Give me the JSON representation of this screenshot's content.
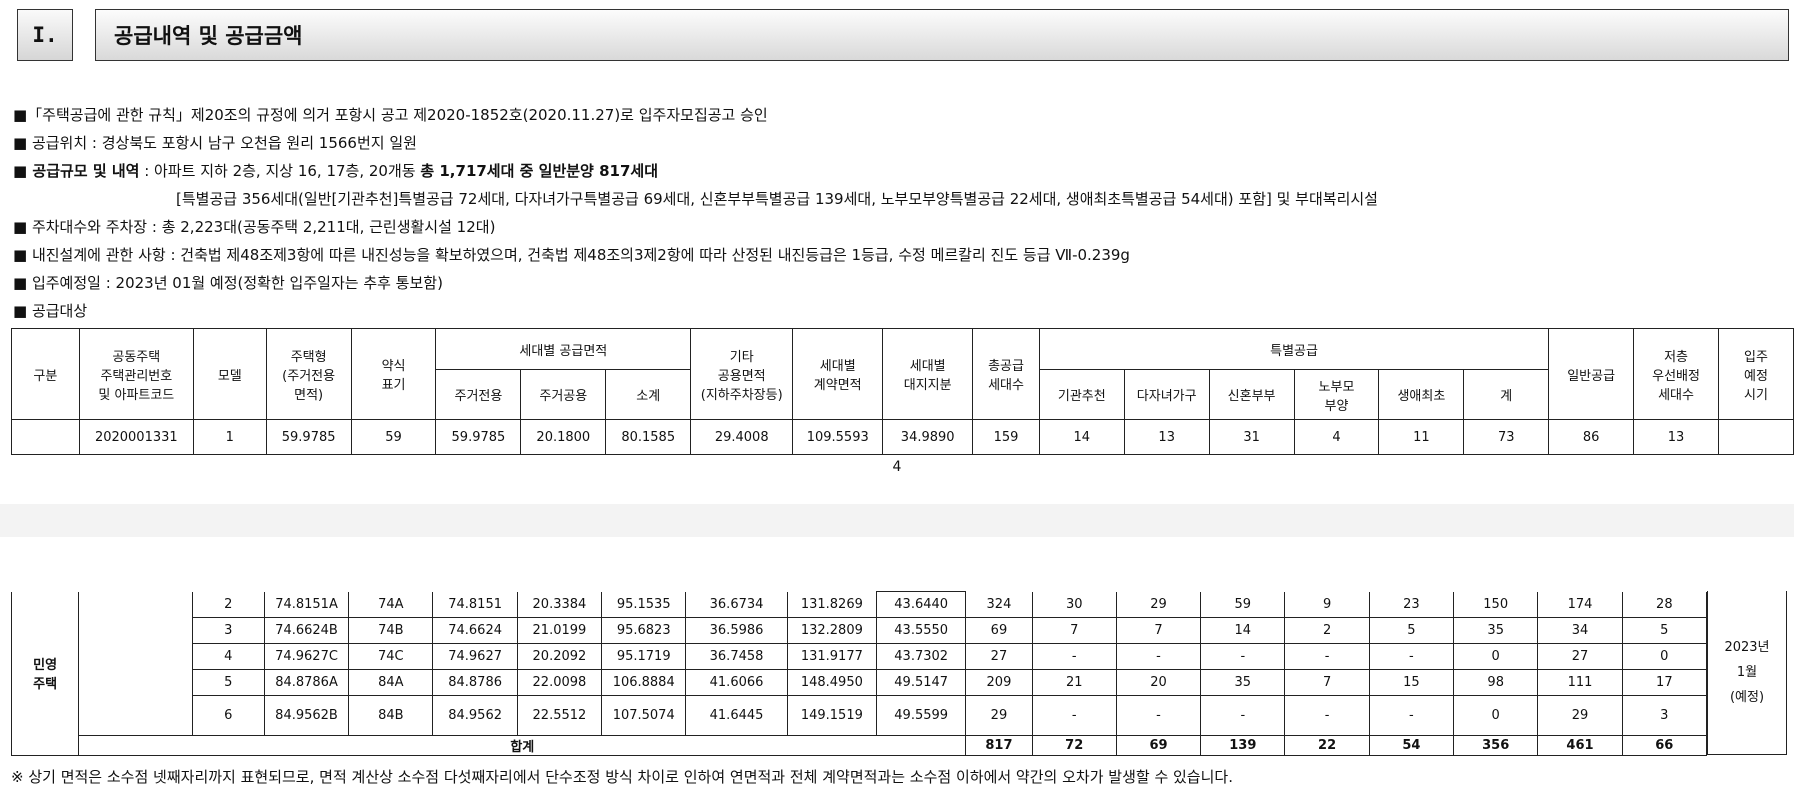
{
  "section": {
    "number": "I.",
    "title": "공급내역 및 공급금액"
  },
  "lines": {
    "l1": "■「주택공급에 관한 규칙」제20조의 규정에 의거 포항시 공고 제2020-1852호(2020.11.27)로 입주자모집공고 승인",
    "l2": "■ 공급위치 : 경상북도 포항시 남구 오천읍 원리 1566번지 일원",
    "l3_a": "■ 공급규모 및 내역",
    "l3_b": " : 아파트 지하 2층, 지상 16, 17층, 20개동 ",
    "l3_c": "총 1,717세대 중 일반분양 817세대",
    "l4": "[특별공급 356세대(일반[기관추천]특별공급 72세대, 다자녀가구특별공급 69세대, 신혼부부특별공급 139세대, 노부모부양특별공급 22세대, 생애최초특별공급 54세대) 포함] 및 부대복리시설",
    "l5": "■ 주차대수와 주차장 : 총 2,223대(공동주택 2,211대, 근린생활시설 12대)",
    "l6": "■ 내진설계에 관한 사항 : 건축법 제48조제3항에 따른 내진성능을 확보하였으며, 건축법 제48조의3제2항에 따라 산정된 내진등급은 1등급, 수정 메르칼리 진도 등급 Ⅶ-0.239g",
    "l7": "■ 입주예정일 : 2023년 01월 예정(정확한 입주일자는 추후 통보함)",
    "l8": "■ 공급대상"
  },
  "table_header": {
    "gubun": "구분",
    "code": "공동주택\n주택관리번호\n및 아파트코드",
    "model": "모델",
    "type": "주택형\n(주거전용\n면적)",
    "abbr": "약식\n표기",
    "area_group": "세대별 공급면적",
    "area_excl": "주거전용",
    "area_common": "주거공용",
    "area_sub": "소계",
    "other": "기타\n공용면적\n(지하주차장등)",
    "contract": "세대별\n계약면적",
    "land": "세대별\n대지지분",
    "total": "총공급\n세대수",
    "special_group": "특별공급",
    "sp_inst": "기관추천",
    "sp_multi": "다자녀가구",
    "sp_newlywed": "신혼부부",
    "sp_parents": "노부모\n부양",
    "sp_first": "생애최초",
    "sp_sum": "계",
    "general": "일반공급",
    "low_floor": "저층\n우선배정\n세대수",
    "move_in": "입주\n예정\n시기"
  },
  "first_row": {
    "code": "2020001331",
    "model": "1",
    "type": "59.9785",
    "abbr": "59",
    "excl": "59.9785",
    "common": "20.1800",
    "sub": "80.1585",
    "other": "29.4008",
    "contract": "109.5593",
    "land": "34.9890",
    "total": "159",
    "inst": "14",
    "multi": "13",
    "newlywed": "31",
    "parents": "4",
    "first": "11",
    "sum": "73",
    "general": "86",
    "low": "13"
  },
  "page_number": "4",
  "category": "민영\n주택",
  "move_in_time": "2023년\n1월\n(예정)",
  "rows": [
    {
      "model": "2",
      "type": "74.8151A",
      "abbr": "74A",
      "excl": "74.8151",
      "common": "20.3384",
      "sub": "95.1535",
      "other": "36.6734",
      "contract": "131.8269",
      "land": "43.6440",
      "total": "324",
      "inst": "30",
      "multi": "29",
      "newlywed": "59",
      "parents": "9",
      "first": "23",
      "sum": "150",
      "general": "174",
      "low": "28"
    },
    {
      "model": "3",
      "type": "74.6624B",
      "abbr": "74B",
      "excl": "74.6624",
      "common": "21.0199",
      "sub": "95.6823",
      "other": "36.5986",
      "contract": "132.2809",
      "land": "43.5550",
      "total": "69",
      "inst": "7",
      "multi": "7",
      "newlywed": "14",
      "parents": "2",
      "first": "5",
      "sum": "35",
      "general": "34",
      "low": "5"
    },
    {
      "model": "4",
      "type": "74.9627C",
      "abbr": "74C",
      "excl": "74.9627",
      "common": "20.2092",
      "sub": "95.1719",
      "other": "36.7458",
      "contract": "131.9177",
      "land": "43.7302",
      "total": "27",
      "inst": "-",
      "multi": "-",
      "newlywed": "-",
      "parents": "-",
      "first": "-",
      "sum": "0",
      "general": "27",
      "low": "0"
    },
    {
      "model": "5",
      "type": "84.8786A",
      "abbr": "84A",
      "excl": "84.8786",
      "common": "22.0098",
      "sub": "106.8884",
      "other": "41.6066",
      "contract": "148.4950",
      "land": "49.5147",
      "total": "209",
      "inst": "21",
      "multi": "20",
      "newlywed": "35",
      "parents": "7",
      "first": "15",
      "sum": "98",
      "general": "111",
      "low": "17"
    },
    {
      "model": "6",
      "type": "84.9562B",
      "abbr": "84B",
      "excl": "84.9562",
      "common": "22.5512",
      "sub": "107.5074",
      "other": "41.6445",
      "contract": "149.1519",
      "land": "49.5599",
      "total": "29",
      "inst": "-",
      "multi": "-",
      "newlywed": "-",
      "parents": "-",
      "first": "-",
      "sum": "0",
      "general": "29",
      "low": "3"
    }
  ],
  "totals": {
    "label": "합계",
    "total": "817",
    "inst": "72",
    "multi": "69",
    "newlywed": "139",
    "parents": "22",
    "first": "54",
    "sum": "356",
    "general": "461",
    "low": "66"
  },
  "note": "※ 상기 면적은 소수점 넷째자리까지 표현되므로, 면적 계산상 소수점 다섯째자리에서 단수조정 방식 차이로 인하여 연면적과 전체 계약면적과는 소수점 이하에서 약간의 오차가 발생할 수 있습니다."
}
